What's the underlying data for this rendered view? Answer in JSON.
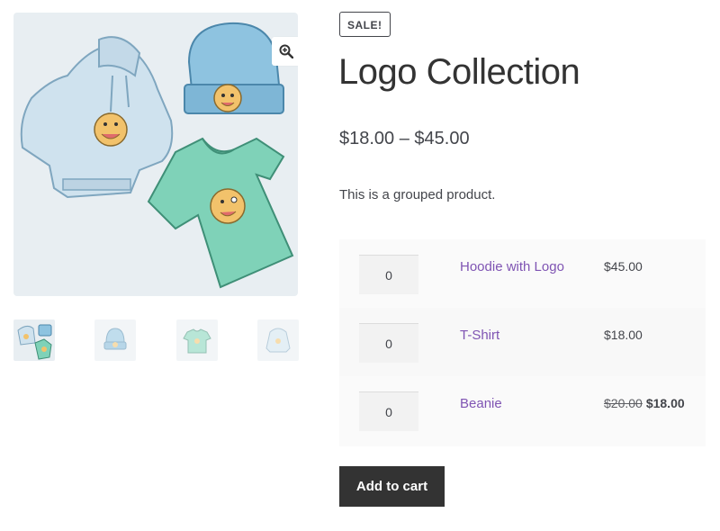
{
  "product": {
    "sale_badge": "SALE!",
    "title": "Logo Collection",
    "price_range": "$18.00 – $45.00",
    "description": "This is a grouped product."
  },
  "gallery": {
    "zoom_icon": "zoom-in-icon",
    "thumbnails": [
      {
        "name": "thumb-logo-collection",
        "active": true
      },
      {
        "name": "thumb-beanie",
        "active": false
      },
      {
        "name": "thumb-tshirt",
        "active": false
      },
      {
        "name": "thumb-hoodie",
        "active": false
      }
    ]
  },
  "grouped_items": [
    {
      "quantity": "0",
      "name": "Hoodie with Logo",
      "price": "$45.00",
      "regular_price": "",
      "sale_price": ""
    },
    {
      "quantity": "0",
      "name": "T-Shirt",
      "price": "$18.00",
      "regular_price": "",
      "sale_price": ""
    },
    {
      "quantity": "0",
      "name": "Beanie",
      "price": "",
      "regular_price": "$20.00",
      "sale_price": "$18.00"
    }
  ],
  "cart": {
    "add_label": "Add to cart"
  },
  "colors": {
    "link": "#7f54b3",
    "button_bg": "#333333",
    "button_text": "#ffffff",
    "text": "#43454b"
  }
}
